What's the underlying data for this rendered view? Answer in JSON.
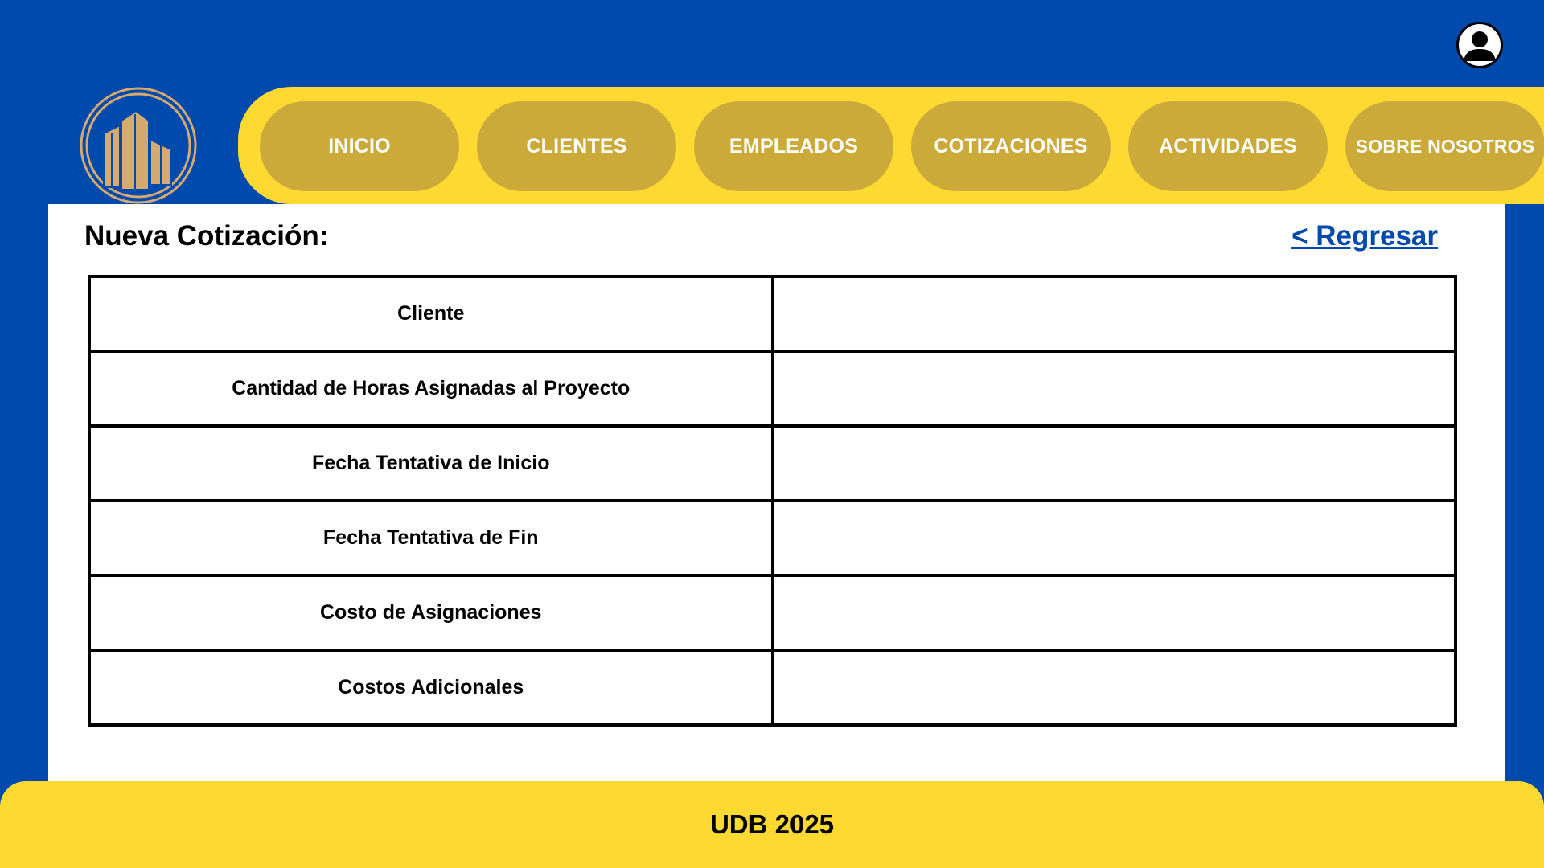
{
  "header": {
    "avatar_icon": "user-profile-icon",
    "logo_icon": "buildings-logo-icon"
  },
  "nav": {
    "items": [
      {
        "label": "INICIO"
      },
      {
        "label": "CLIENTES"
      },
      {
        "label": "EMPLEADOS"
      },
      {
        "label": "COTIZACIONES"
      },
      {
        "label": "ACTIVIDADES"
      },
      {
        "label": "SOBRE NOSOTROS"
      }
    ]
  },
  "main": {
    "title": "Nueva Cotización:",
    "back_link": "< Regresar",
    "fields": [
      {
        "label": "Cliente",
        "value": ""
      },
      {
        "label": "Cantidad de Horas Asignadas al Proyecto",
        "value": ""
      },
      {
        "label": "Fecha Tentativa de Inicio",
        "value": ""
      },
      {
        "label": "Fecha Tentativa de Fin",
        "value": ""
      },
      {
        "label": "Costo de Asignaciones",
        "value": ""
      },
      {
        "label": "Costos Adicionales",
        "value": ""
      }
    ]
  },
  "footer": {
    "text": "UDB 2025"
  },
  "colors": {
    "primary_blue": "#004aad",
    "accent_yellow": "#fed932",
    "nav_button": "#cbaa39",
    "logo_gold": "#d4aa6f"
  }
}
